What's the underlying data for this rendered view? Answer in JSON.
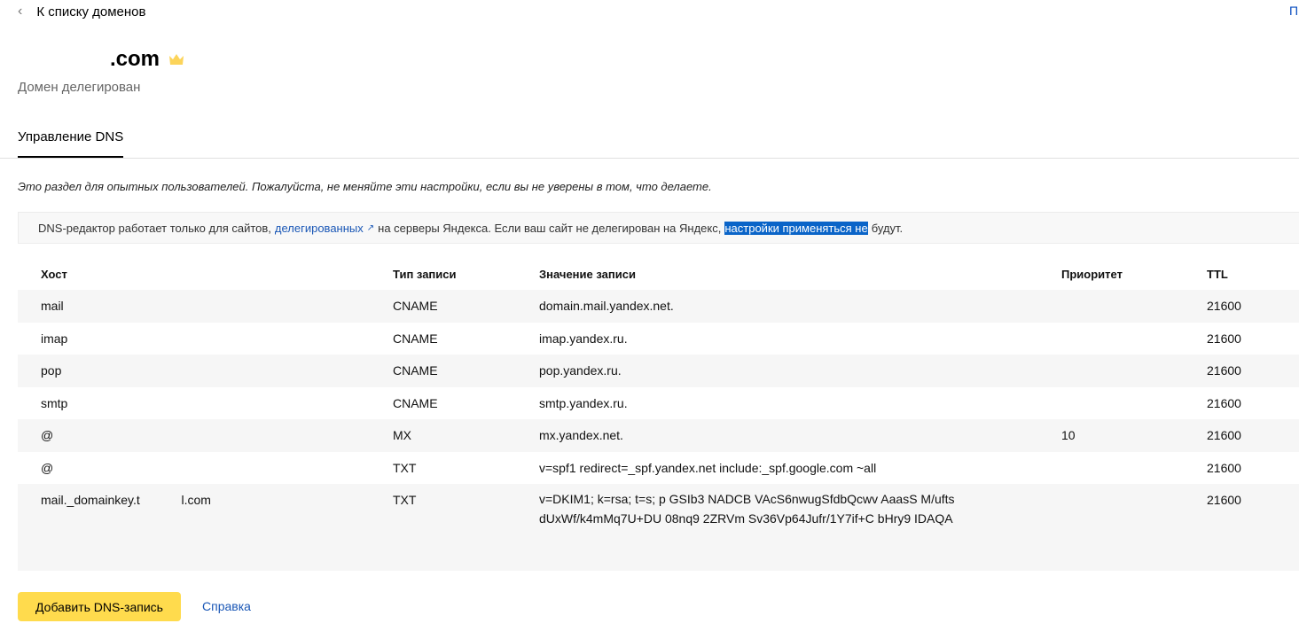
{
  "nav": {
    "back_label": "К списку доменов",
    "corner_text": "П"
  },
  "domain": {
    "name": ".com",
    "status": "Домен делегирован",
    "crown_color": "#fcd45a"
  },
  "tabs": [
    {
      "label": "Управление DNS",
      "active": true
    }
  ],
  "warning": "Это раздел для опытных пользователей. Пожалуйста, не меняйте эти настройки, если вы не уверены в том, что делаете.",
  "info": {
    "before": "DNS-редактор работает только для сайтов,",
    "link": "делегированных",
    "middle": "на серверы Яндекса. Если ваш сайт не делегирован на Яндекс,",
    "highlight": "настройки применяться не",
    "after": "будут."
  },
  "table": {
    "headers": {
      "host": "Хост",
      "type": "Тип записи",
      "value": "Значение записи",
      "priority": "Приоритет",
      "ttl": "TTL"
    },
    "rows": [
      {
        "host": "mail",
        "type": "CNAME",
        "value": "domain.mail.yandex.net.",
        "priority": "",
        "ttl": "21600"
      },
      {
        "host": "imap",
        "type": "CNAME",
        "value": "imap.yandex.ru.",
        "priority": "",
        "ttl": "21600"
      },
      {
        "host": "pop",
        "type": "CNAME",
        "value": "pop.yandex.ru.",
        "priority": "",
        "ttl": "21600"
      },
      {
        "host": "smtp",
        "type": "CNAME",
        "value": "smtp.yandex.ru.",
        "priority": "",
        "ttl": "21600"
      },
      {
        "host": "@",
        "type": "MX",
        "value": "mx.yandex.net.",
        "priority": "10",
        "ttl": "21600"
      },
      {
        "host": "@",
        "type": "TXT",
        "value": "v=spf1 redirect=_spf.yandex.net include:_spf.google.com ~all",
        "priority": "",
        "ttl": "21600"
      },
      {
        "host": "mail._domainkey.t            l.com",
        "type": "TXT",
        "value": "v=DKIM1; k=rsa; t=s; p                              GSIb3                    NADCB VAcS6nwugSfdbQcwv                              AaasS                    M/ufts dUxWf/k4mMq7U+DU                              08nq9                    2ZRVm Sv36Vp64Jufr/1Y7if+C                              bHry9                    IDAQA",
        "priority": "",
        "ttl": "21600"
      }
    ]
  },
  "actions": {
    "add_label": "Добавить DNS-запись",
    "help_label": "Справка"
  }
}
